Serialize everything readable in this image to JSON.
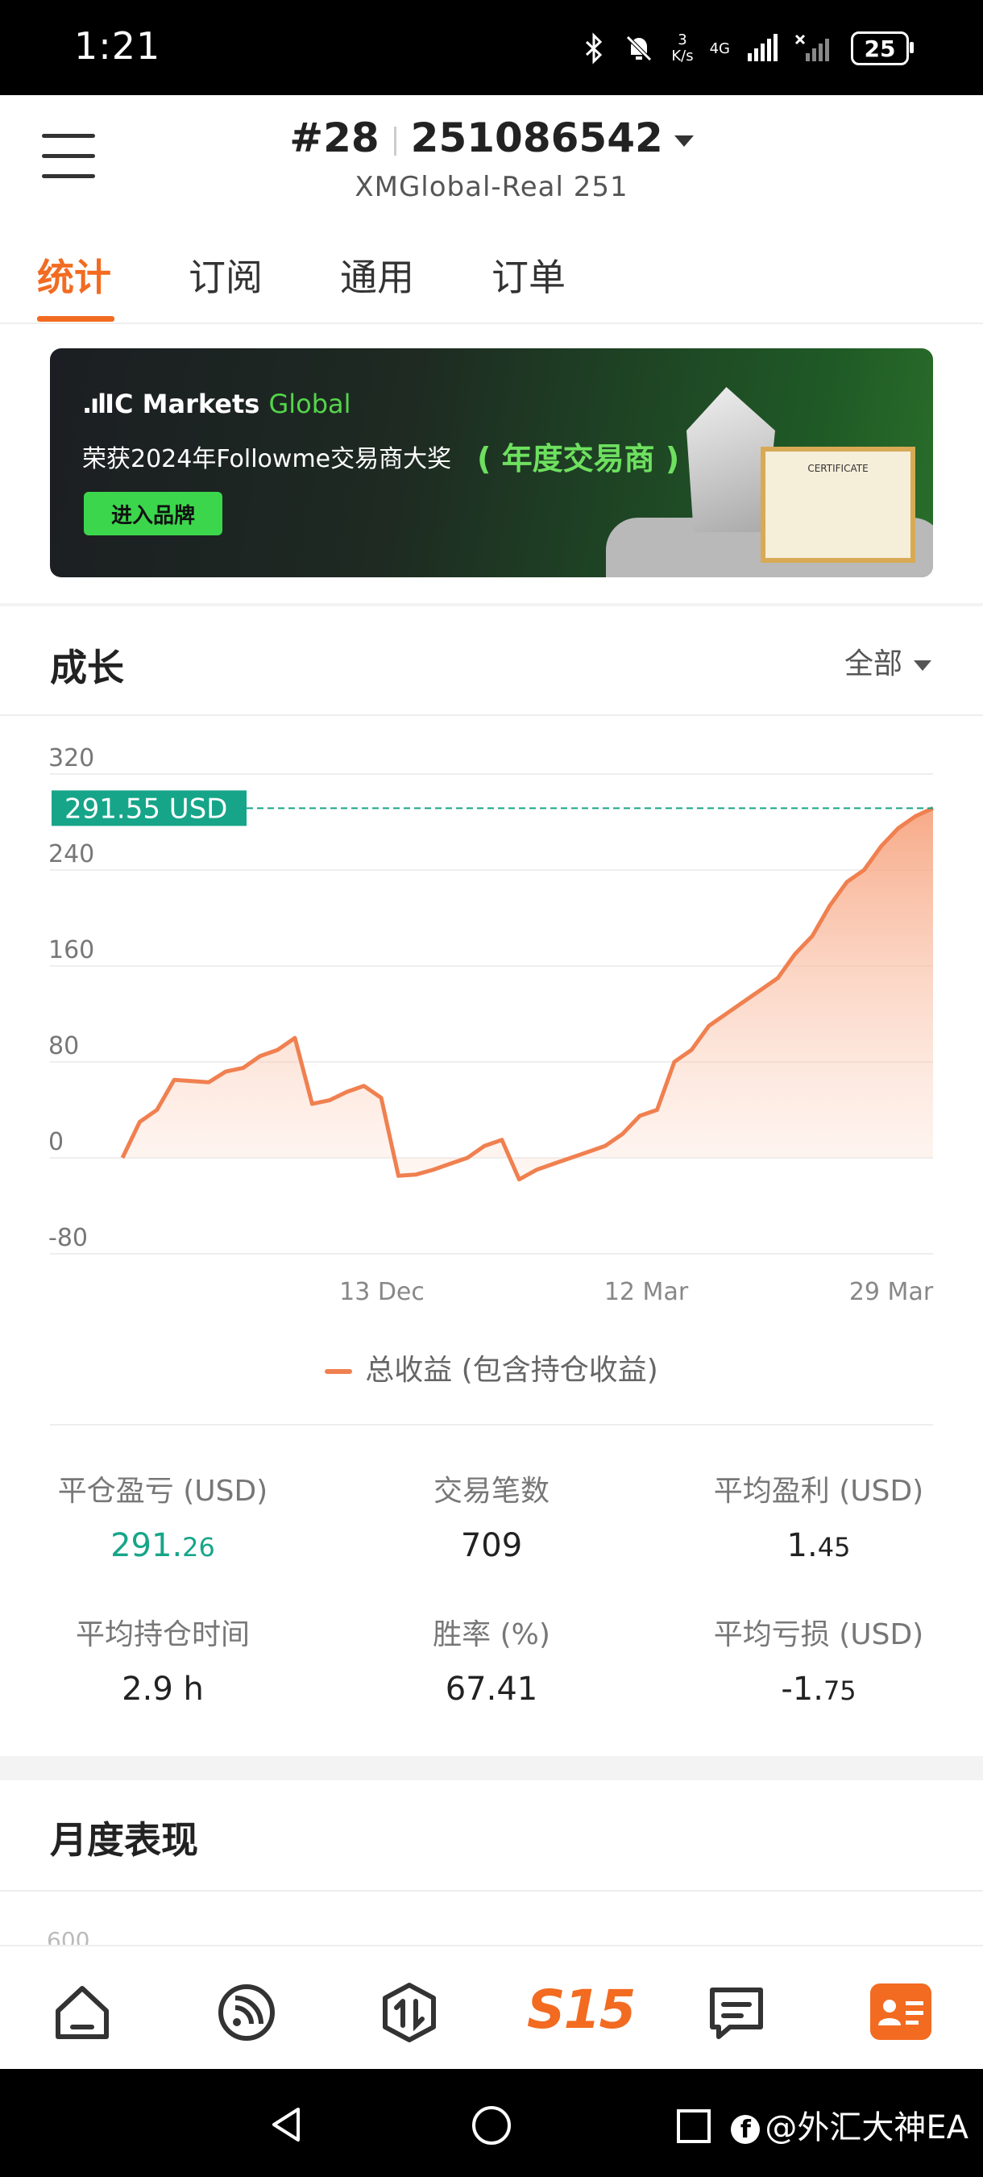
{
  "status_bar": {
    "time": "1:21",
    "speed_value": "3",
    "speed_unit": "K/s",
    "network": "4G",
    "battery": "25"
  },
  "header": {
    "rank": "#28",
    "account": "251086542",
    "server": "XMGlobal-Real 251"
  },
  "tabs": [
    {
      "label": "统计",
      "active": true
    },
    {
      "label": "订阅",
      "active": false
    },
    {
      "label": "通用",
      "active": false
    },
    {
      "label": "订单",
      "active": false
    }
  ],
  "banner": {
    "brand_main": "IC Markets",
    "brand_sub": "Global",
    "line": "荣获2024年Followme交易商大奖",
    "award": "年度交易商",
    "button": "进入品牌",
    "certificate": "CERTIFICATE"
  },
  "growth": {
    "title": "成长",
    "range": "全部"
  },
  "chart_data": {
    "type": "area",
    "y_ticks": [
      "320",
      "240",
      "160",
      "80",
      "0",
      "-80"
    ],
    "ylim": [
      -80,
      320
    ],
    "x_ticks": [
      "13 Dec",
      "12 Mar",
      "29 Mar"
    ],
    "current_label": "291.55 USD",
    "current_value": 291.55,
    "series": [
      {
        "name": "总收益 (包含持仓收益)",
        "color": "#f08050",
        "values": [
          0,
          30,
          40,
          65,
          64,
          63,
          72,
          75,
          85,
          90,
          100,
          45,
          48,
          55,
          60,
          50,
          -15,
          -14,
          -10,
          -5,
          0,
          10,
          15,
          -18,
          -10,
          -5,
          0,
          5,
          10,
          20,
          35,
          40,
          80,
          90,
          110,
          120,
          130,
          140,
          150,
          170,
          185,
          210,
          230,
          240,
          260,
          275,
          285,
          291.55
        ]
      }
    ]
  },
  "legend": {
    "label": "总收益 (包含持仓收益)"
  },
  "stats": {
    "closed_pl_label": "平仓盈亏 (USD)",
    "closed_pl_int": "291.",
    "closed_pl_dec": "26",
    "trades_label": "交易笔数",
    "trades_value": "709",
    "avg_profit_label": "平均盈利 (USD)",
    "avg_profit_int": "1.",
    "avg_profit_dec": "45",
    "avg_hold_label": "平均持仓时间",
    "avg_hold_value": "2.9 h",
    "winrate_label": "胜率 (%)",
    "winrate_value": "67.41",
    "avg_loss_label": "平均亏损 (USD)",
    "avg_loss_int": "-1.",
    "avg_loss_dec": "75"
  },
  "monthly": {
    "title": "月度表现",
    "peek_value": "600"
  },
  "bottom_nav": [
    "home",
    "feed",
    "trade",
    "S15",
    "messages",
    "profile"
  ],
  "sys_nav": {
    "watermark": "@外汇大神EA"
  }
}
